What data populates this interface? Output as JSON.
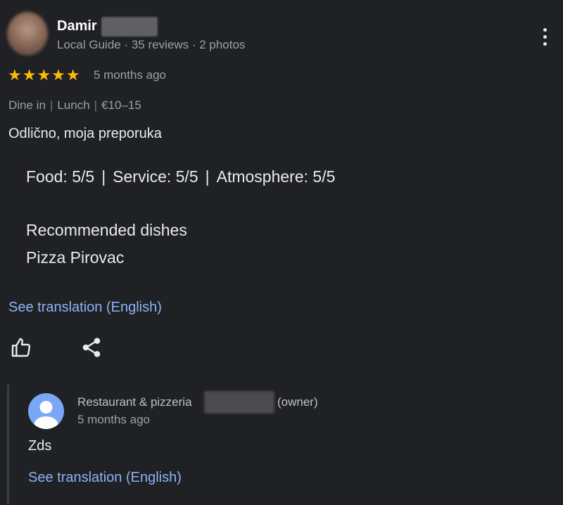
{
  "review": {
    "reviewer_name": "Damir",
    "reviewer_meta": "Local Guide · 35 reviews · 2 photos",
    "stars": "★★★★★",
    "rating": 5,
    "time_ago": "5 months ago",
    "tags": [
      "Dine in",
      "Lunch",
      "€10–15"
    ],
    "text": "Odlično, moja preporuka",
    "ratings": [
      "Food: 5/5",
      "Service: 5/5",
      "Atmosphere: 5/5"
    ],
    "recommended_title": "Recommended dishes",
    "recommended_dish": "Pizza Pirovac",
    "see_translation": "See translation (English)"
  },
  "owner_reply": {
    "name": "Restaurant & pizzeria",
    "tag": "(owner)",
    "time_ago": "5 months ago",
    "text": "Zds",
    "see_translation": "See translation (English)"
  },
  "icons": [
    "more-vert-icon",
    "thumb-up-icon",
    "share-icon",
    "person-icon"
  ],
  "colors": {
    "background": "#202124",
    "link": "#8ab4f8",
    "star": "#fbbc04",
    "owner_avatar": "#7aa7f5"
  }
}
